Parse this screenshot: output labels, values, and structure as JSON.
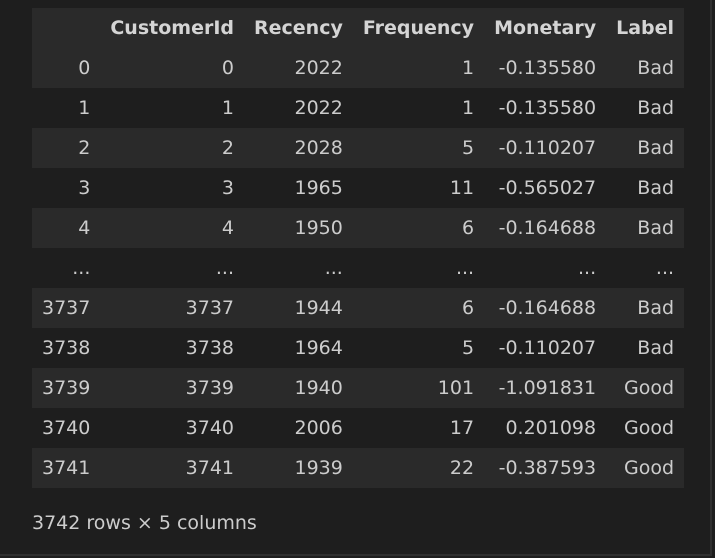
{
  "table": {
    "columns": [
      "",
      "CustomerId",
      "Recency",
      "Frequency",
      "Monetary",
      "Label"
    ],
    "rows": [
      [
        "0",
        "0",
        "2022",
        "1",
        "-0.135580",
        "Bad"
      ],
      [
        "1",
        "1",
        "2022",
        "1",
        "-0.135580",
        "Bad"
      ],
      [
        "2",
        "2",
        "2028",
        "5",
        "-0.110207",
        "Bad"
      ],
      [
        "3",
        "3",
        "1965",
        "11",
        "-0.565027",
        "Bad"
      ],
      [
        "4",
        "4",
        "1950",
        "6",
        "-0.164688",
        "Bad"
      ],
      [
        "...",
        "...",
        "...",
        "...",
        "...",
        "..."
      ],
      [
        "3737",
        "3737",
        "1944",
        "6",
        "-0.164688",
        "Bad"
      ],
      [
        "3738",
        "3738",
        "1964",
        "5",
        "-0.110207",
        "Bad"
      ],
      [
        "3739",
        "3739",
        "1940",
        "101",
        "-1.091831",
        "Good"
      ],
      [
        "3740",
        "3740",
        "2006",
        "17",
        "0.201098",
        "Good"
      ],
      [
        "3741",
        "3741",
        "1939",
        "22",
        "-0.387593",
        "Good"
      ]
    ]
  },
  "summary": "3742 rows × 5 columns",
  "colors": {
    "background": "#1e1e1e",
    "row_stripe": "#2a2a2a",
    "text": "#cccccc"
  }
}
